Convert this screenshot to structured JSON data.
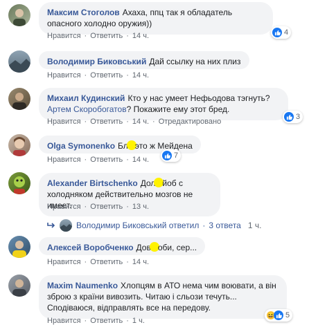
{
  "comments": [
    {
      "author": "Максим Стоголов",
      "text_parts": [
        "Ахаха, ппц так я обладатель опасного холодно оружия))"
      ],
      "actions": {
        "like": "Нравится",
        "reply": "Ответить",
        "time": "14 ч."
      },
      "reactions": {
        "count": "4",
        "types": [
          "like-icon"
        ]
      }
    },
    {
      "author": "Володимир Биковський",
      "text_parts": [
        "Дай ссылку на них плиз"
      ],
      "actions": {
        "like": "Нравится",
        "reply": "Ответить",
        "time": "14 ч."
      }
    },
    {
      "author": "Михаил Кудинский",
      "text_parts": [
        "Кто у нас умеет Нефьодова тэгнуть?",
        "Артем Скоробогатов",
        "? Покажите ему этот бред."
      ],
      "actions": {
        "like": "Нравится",
        "reply": "Ответить",
        "time": "14 ч.",
        "edited": "Отредактировано"
      },
      "reactions": {
        "count": "3",
        "types": [
          "like-icon"
        ]
      }
    },
    {
      "author": "Olga Symonenko",
      "text_parts": [
        "Бл",
        "это ж Мейдена"
      ],
      "actions": {
        "like": "Нравится",
        "reply": "Ответить",
        "time": "14 ч."
      },
      "reactions": {
        "count": "7",
        "types": [
          "like-icon"
        ]
      }
    },
    {
      "author": "Alexander Birtschenko",
      "text_parts": [
        "Дол",
        "йоб с холодняком действительно мозгов не имеет."
      ],
      "actions": {
        "like": "Нравится",
        "reply": "Ответить",
        "time": "13 ч."
      },
      "replies": {
        "author": "Володимир Биковський",
        "verb": "ответил",
        "count": "3 ответа",
        "time": "1 ч."
      }
    },
    {
      "author": "Алексей Воробченко",
      "text_parts": [
        "Дов",
        "оби, сер..."
      ],
      "actions": {
        "like": "Нравится",
        "reply": "Ответить",
        "time": "14 ч."
      }
    },
    {
      "author": "Maxim Naumenko",
      "text_parts": [
        "Хлопцям в АТО нема чим воювати, а він зброю з країни вивозить. Читаю і сльози течуть... Сподіваюся, відправлять все на передову."
      ],
      "actions": {
        "like": "Нравится",
        "reply": "Ответить",
        "time": "1 ч."
      },
      "reactions": {
        "count": "5",
        "types": [
          "haha-icon",
          "like-icon"
        ]
      }
    }
  ],
  "separator": "·",
  "colors": {
    "link": "#385898",
    "bubble": "#f2f3f5",
    "meta": "#606770",
    "like": "#1877f2",
    "censor": "#fff200"
  }
}
